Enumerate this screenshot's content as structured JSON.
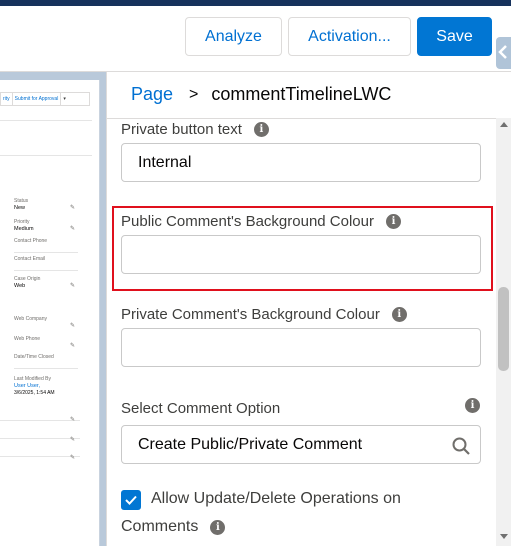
{
  "toolbar": {
    "analyze": "Analyze",
    "activation": "Activation...",
    "save": "Save"
  },
  "preview": {
    "actions": [
      "rity",
      "Submit for Approval"
    ],
    "fields": [
      {
        "label": "Status",
        "value": "New"
      },
      {
        "label": "Priority",
        "value": "Medium"
      },
      {
        "label": "Contact Phone",
        "value": ""
      },
      {
        "label": "Contact Email",
        "value": ""
      },
      {
        "label": "Case Origin",
        "value": "Web"
      },
      {
        "label": "Web Company",
        "value": ""
      },
      {
        "label": "Web Phone",
        "value": ""
      },
      {
        "label": "Date/Time Closed",
        "value": ""
      },
      {
        "label": "Last Modified By",
        "value": "User User,"
      },
      {
        "label": "",
        "value": "3/6/2025, 1:54 AM"
      }
    ]
  },
  "breadcrumb": {
    "root": "Page",
    "separator": ">",
    "current": "commentTimelineLWC"
  },
  "properties": {
    "private_button_text": {
      "label": "Private button text",
      "value": "Internal"
    },
    "public_bg": {
      "label": "Public Comment's Background Colour",
      "value": ""
    },
    "private_bg": {
      "label": "Private Comment's Background Colour",
      "value": ""
    },
    "comment_option": {
      "label": "Select Comment Option",
      "value": "Create Public/Private Comment"
    },
    "allow_update": {
      "label_line1": "Allow Update/Delete Operations on",
      "label_line2": "Comments",
      "checked": true
    }
  },
  "colors": {
    "brand": "#0176d3",
    "highlight": "#e0101d",
    "link": "#0070d2"
  },
  "icons": [
    "info-icon",
    "search-icon",
    "checkmark-icon",
    "pencil-icon",
    "chevron-left-icon"
  ]
}
